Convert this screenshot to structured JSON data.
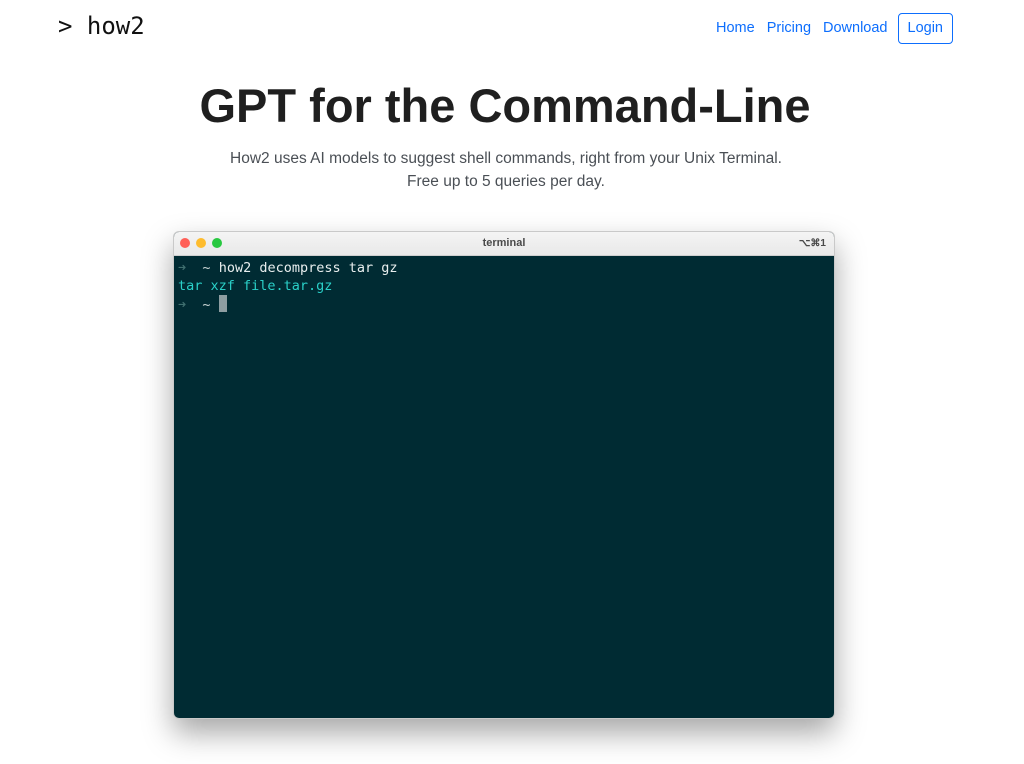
{
  "navbar": {
    "brand": "> how2",
    "links": [
      {
        "label": "Home"
      },
      {
        "label": "Pricing"
      },
      {
        "label": "Download"
      }
    ],
    "login_label": "Login"
  },
  "hero": {
    "title": "GPT for the Command-Line",
    "subtitle_line1": "How2 uses AI models to suggest shell commands, right from your Unix Terminal.",
    "subtitle_line2": "Free up to 5 queries per day."
  },
  "terminal": {
    "title": "terminal",
    "shortcut": "⌥⌘1",
    "prompt_arrow": "➜",
    "prompt_path": "~",
    "command": "how2 decompress tar gz",
    "output": "tar xzf file.tar.gz",
    "colors": {
      "background": "#002b33",
      "output": "#2ad0c8",
      "cursor": "#8e9ea2"
    }
  },
  "colors": {
    "link": "#0d6efd",
    "title": "#1f1f1f",
    "subtitle": "#4a4f55"
  }
}
